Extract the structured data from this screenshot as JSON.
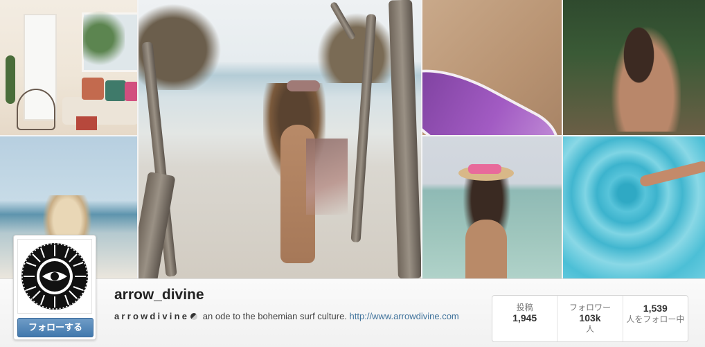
{
  "profile": {
    "username": "arrow_divine",
    "bio_brand": "arrowdivine",
    "bio_text": " an ode to the bohemian surf culture. ",
    "website": "http://www.arrowdivine.com",
    "follow_label": "フォローする"
  },
  "stats": [
    {
      "label": "投稿",
      "value": "1,945",
      "unit": ""
    },
    {
      "label": "フォロワー",
      "value": "103k",
      "unit": "人"
    },
    {
      "label": "",
      "value": "1,539",
      "unit": "人をフォロー中"
    }
  ],
  "photos": [
    {
      "name": "photo-boho-interior"
    },
    {
      "name": "photo-beach-blonde"
    },
    {
      "name": "photo-beach-main"
    },
    {
      "name": "photo-surfboard"
    },
    {
      "name": "photo-hair-tie"
    },
    {
      "name": "photo-sea-hat"
    },
    {
      "name": "photo-pool-swirl"
    }
  ],
  "colors": {
    "follow_button": "#4178ad",
    "link": "#3f729b",
    "surfboard": "#8e4db3"
  }
}
